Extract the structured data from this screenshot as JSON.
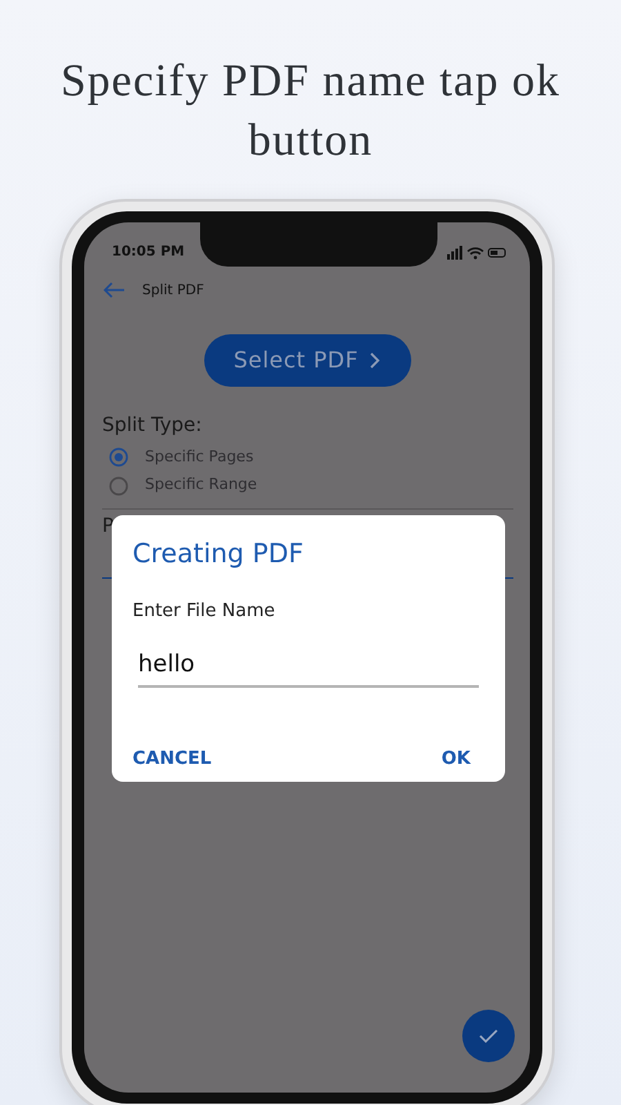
{
  "headline": "Specify PDF name tap ok button",
  "status_bar": {
    "time": "10:05 PM"
  },
  "app_bar": {
    "title": "Split PDF"
  },
  "select_button": {
    "label": "Select PDF"
  },
  "split_type": {
    "label": "Split Type:",
    "options": [
      {
        "label": "Specific Pages",
        "selected": true
      },
      {
        "label": "Specific Range",
        "selected": false
      }
    ]
  },
  "page_numbers": {
    "label": "P"
  },
  "dialog": {
    "title": "Creating PDF",
    "field_label": "Enter File Name",
    "value": "hello",
    "buttons": [
      {
        "label": "CANCEL"
      },
      {
        "label": "OK"
      }
    ]
  }
}
